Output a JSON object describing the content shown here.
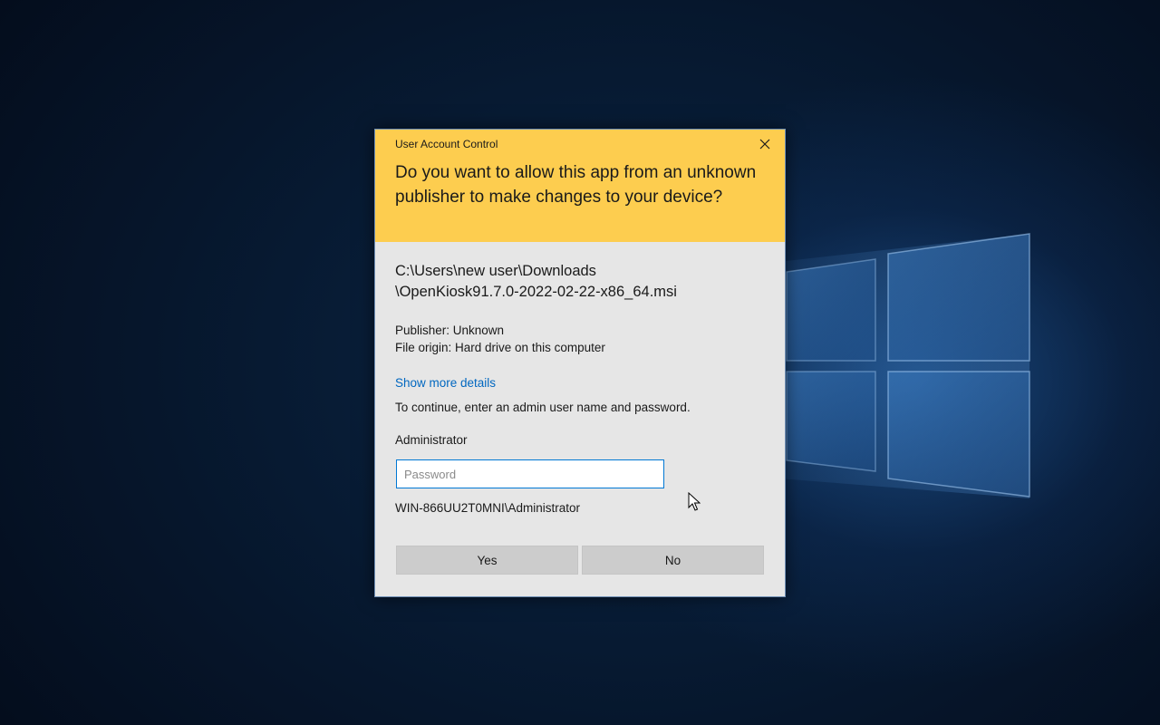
{
  "dialog": {
    "title": "User Account Control",
    "headline": "Do you want to allow this app from an unknown publisher to make changes to your device?",
    "path_line1": "C:\\Users\\new user\\Downloads",
    "path_line2": "\\OpenKiosk91.7.0-2022-02-22-x86_64.msi",
    "publisher": "Publisher: Unknown",
    "file_origin": "File origin: Hard drive on this computer",
    "show_more_details": "Show more details",
    "instruction": "To continue, enter an admin user name and password.",
    "account_name": "Administrator",
    "password_placeholder": "Password",
    "password_value": "",
    "account_domain": "WIN-866UU2T0MNI\\Administrator",
    "yes_label": "Yes",
    "no_label": "No",
    "close_icon": "close-icon"
  },
  "colors": {
    "header_bg": "#fdcd4f",
    "dialog_bg": "#e6e6e6",
    "link": "#0067c0",
    "input_border": "#0078d4",
    "button_bg": "#cccccc"
  }
}
